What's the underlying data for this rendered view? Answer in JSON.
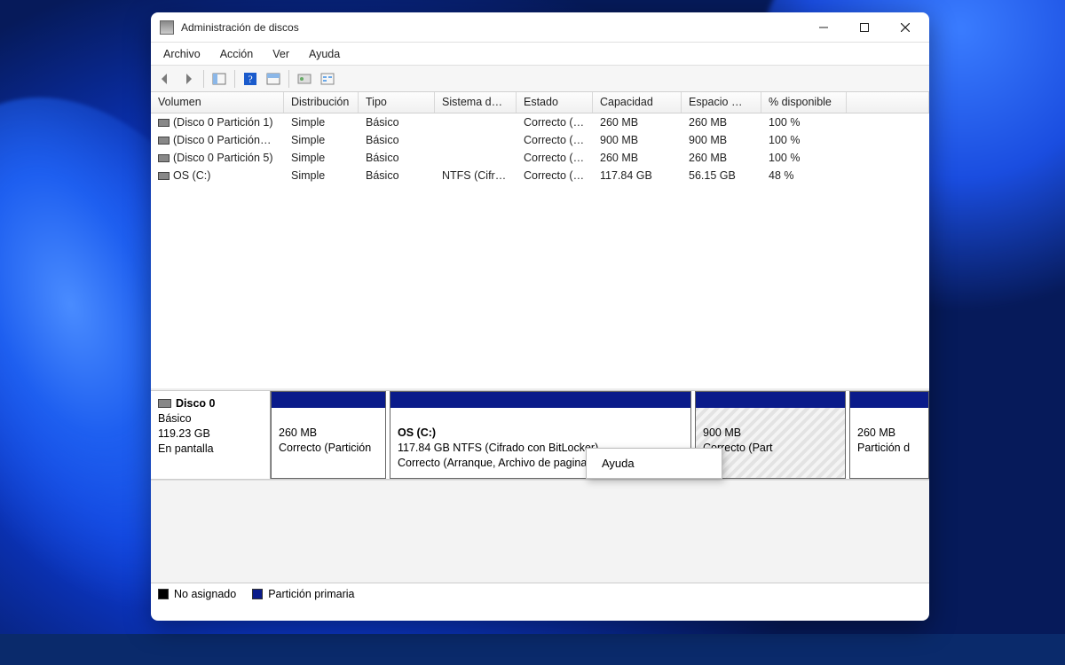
{
  "window": {
    "title": "Administración de discos"
  },
  "menubar": {
    "items": [
      "Archivo",
      "Acción",
      "Ver",
      "Ayuda"
    ]
  },
  "columns": {
    "volumen": "Volumen",
    "distribucion": "Distribución",
    "tipo": "Tipo",
    "sistema": "Sistema de …",
    "estado": "Estado",
    "capacidad": "Capacidad",
    "espacio": "Espacio …",
    "pct": "% disponible"
  },
  "volumes": [
    {
      "name": "(Disco 0 Partición 1)",
      "dist": "Simple",
      "tipo": "Básico",
      "sis": "",
      "estado": "Correcto (…",
      "cap": "260 MB",
      "esp": "260 MB",
      "pct": "100 %"
    },
    {
      "name": "(Disco 0 Partición…",
      "dist": "Simple",
      "tipo": "Básico",
      "sis": "",
      "estado": "Correcto (…",
      "cap": "900 MB",
      "esp": "900 MB",
      "pct": "100 %"
    },
    {
      "name": "(Disco 0 Partición 5)",
      "dist": "Simple",
      "tipo": "Básico",
      "sis": "",
      "estado": "Correcto (…",
      "cap": "260 MB",
      "esp": "260 MB",
      "pct": "100 %"
    },
    {
      "name": "OS (C:)",
      "dist": "Simple",
      "tipo": "Básico",
      "sis": "NTFS (Cifra…",
      "estado": "Correcto (…",
      "cap": "117.84 GB",
      "esp": "56.15 GB",
      "pct": "48 %"
    }
  ],
  "disk": {
    "title": "Disco 0",
    "type": "Básico",
    "size": "119.23 GB",
    "status": "En pantalla"
  },
  "partitions": [
    {
      "size": "260 MB",
      "status": "Correcto (Partición"
    },
    {
      "title": "OS  (C:)",
      "line2": "117.84 GB NTFS (Cifrado con BitLocker)",
      "status": "Correcto (Arranque, Archivo de paginación, V"
    },
    {
      "size": "900 MB",
      "status": "Correcto (Part"
    },
    {
      "size": "260 MB",
      "status": "Partición d"
    }
  ],
  "legend": {
    "unassigned": "No asignado",
    "primary": "Partición primaria"
  },
  "context_menu": {
    "item": "Ayuda"
  }
}
